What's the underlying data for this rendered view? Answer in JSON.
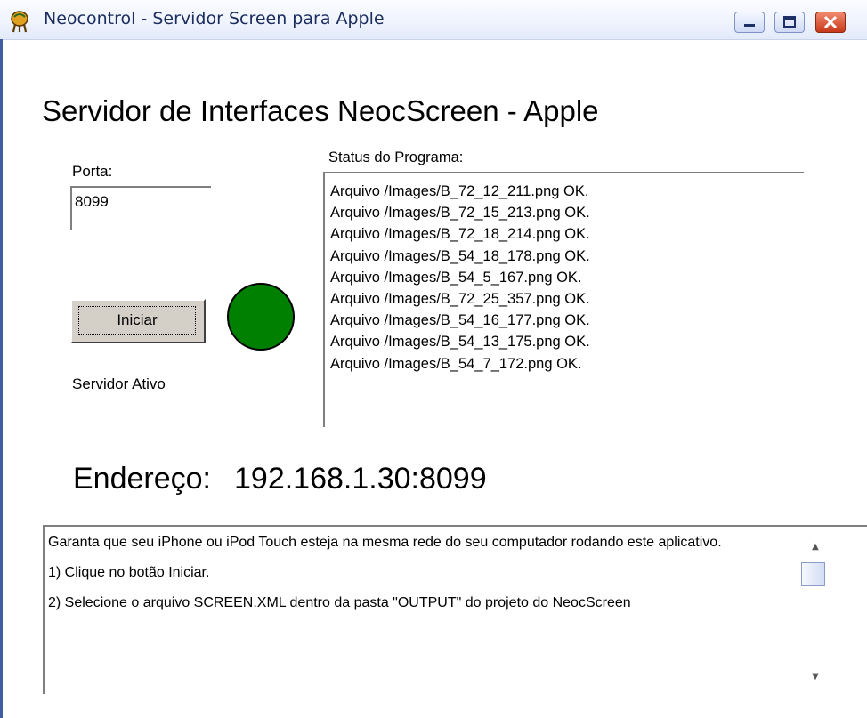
{
  "window": {
    "title": "Neocontrol - Servidor Screen para Apple",
    "icon": "app-icon"
  },
  "main": {
    "heading": "Servidor de Interfaces NeocScreen - Apple",
    "porta_label": "Porta:",
    "porta_value": "8099",
    "iniciar_label": "Iniciar",
    "server_status": "Servidor Ativo",
    "indicator_color": "#008000",
    "status_label": "Status do Programa:",
    "status_lines": [
      "Arquivo /Images/B_72_12_211.png OK.",
      "Arquivo /Images/B_72_15_213.png OK.",
      "Arquivo /Images/B_72_18_214.png OK.",
      "Arquivo /Images/B_54_18_178.png OK.",
      "Arquivo /Images/B_54_5_167.png OK.",
      "Arquivo /Images/B_72_25_357.png OK.",
      "Arquivo /Images/B_54_16_177.png OK.",
      "Arquivo /Images/B_54_13_175.png OK.",
      "Arquivo /Images/B_54_7_172.png OK."
    ],
    "address_label": "Endereço:",
    "address_value": "192.168.1.30:8099"
  },
  "info": {
    "paragraphs": [
      "Garanta que seu iPhone ou iPod Touch esteja na mesma rede do seu computador rodando este aplicativo.",
      "1) Clique no botão Iniciar.",
      "2) Selecione o arquivo SCREEN.XML dentro da pasta \"OUTPUT\" do projeto do NeocScreen"
    ]
  }
}
